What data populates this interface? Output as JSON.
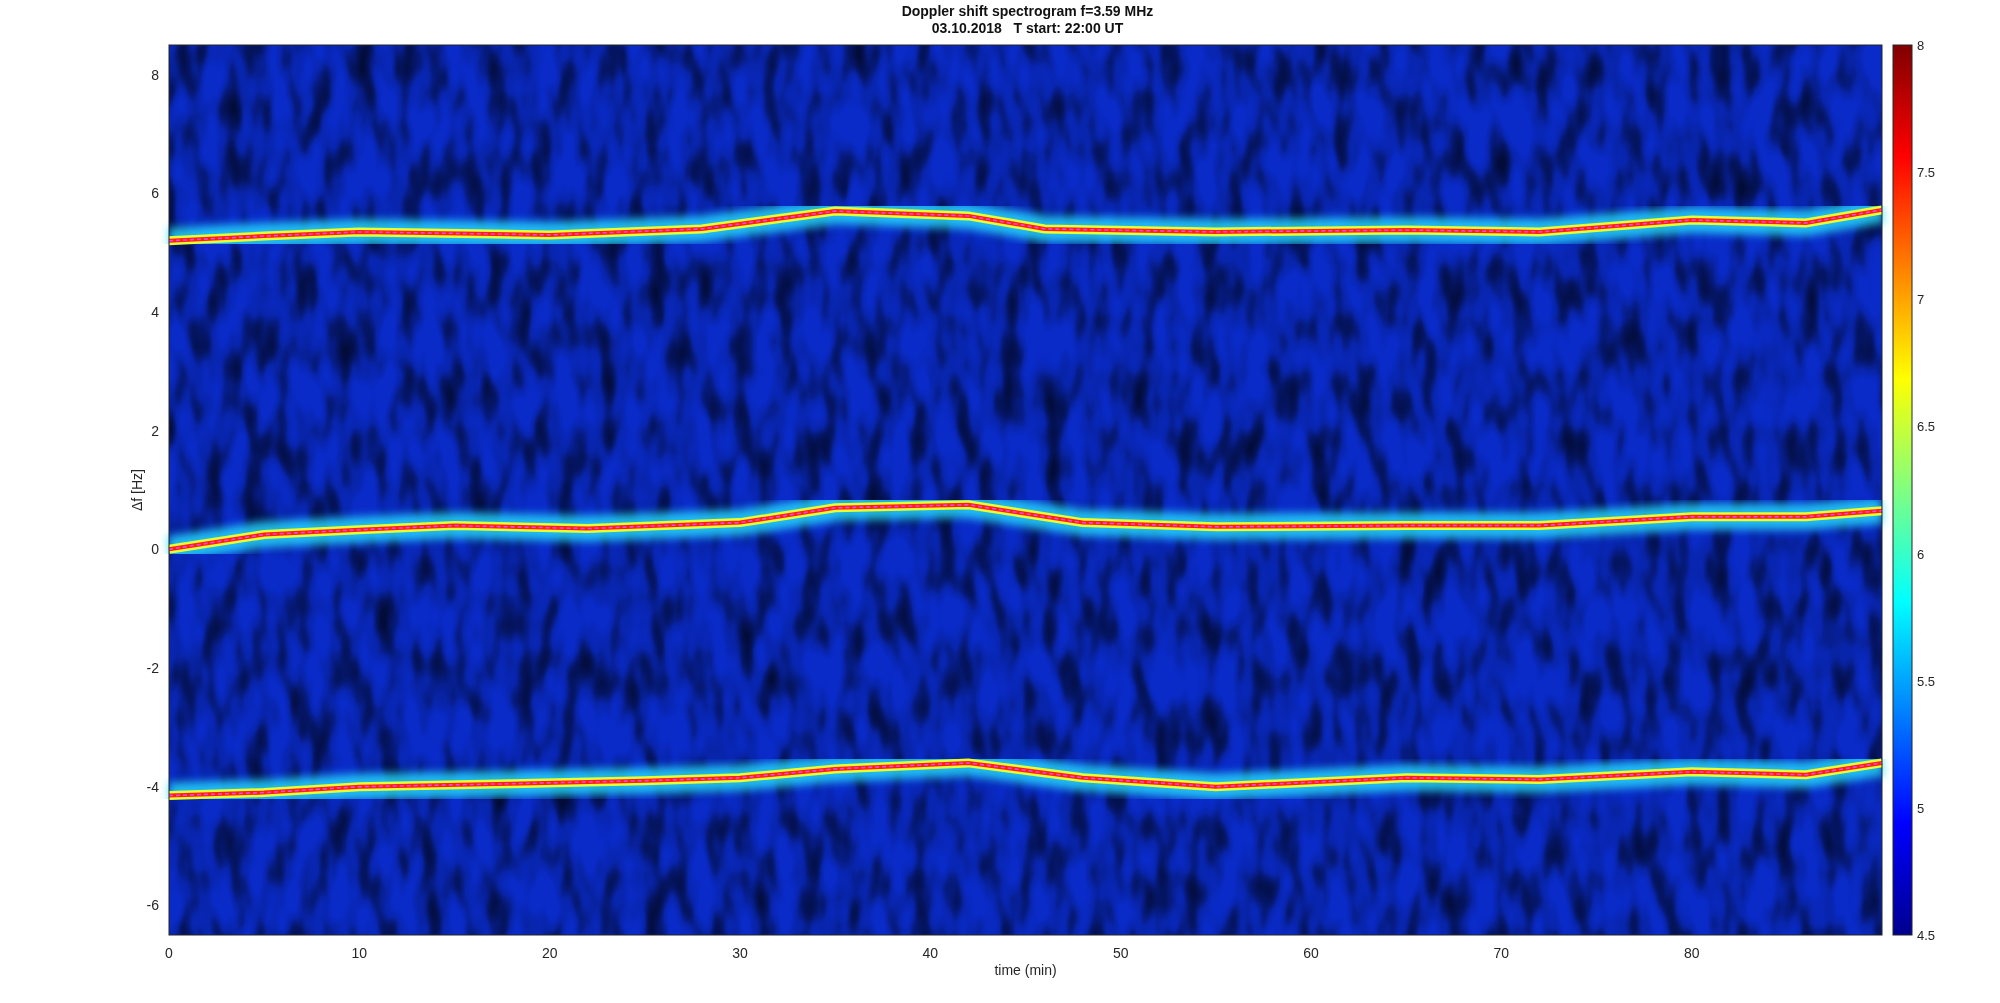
{
  "figure": {
    "title": "Doppler shift spectrogram f=3.59 MHz",
    "subtitle": "03.10.2018   T start: 22:00 UT"
  },
  "axes": {
    "xlabel": "time (min)",
    "ylabel": "Δf [Hz]",
    "xticks": [
      "0",
      "10",
      "20",
      "30",
      "40",
      "50",
      "60",
      "70",
      "80"
    ],
    "yticks": [
      "8",
      "6",
      "4",
      "2",
      "0",
      "-2",
      "-4",
      "-6"
    ]
  },
  "colorbar": {
    "ticks": [
      "8",
      "7.5",
      "7",
      "6.5",
      "6",
      "5.5",
      "5",
      "4.5"
    ]
  }
}
